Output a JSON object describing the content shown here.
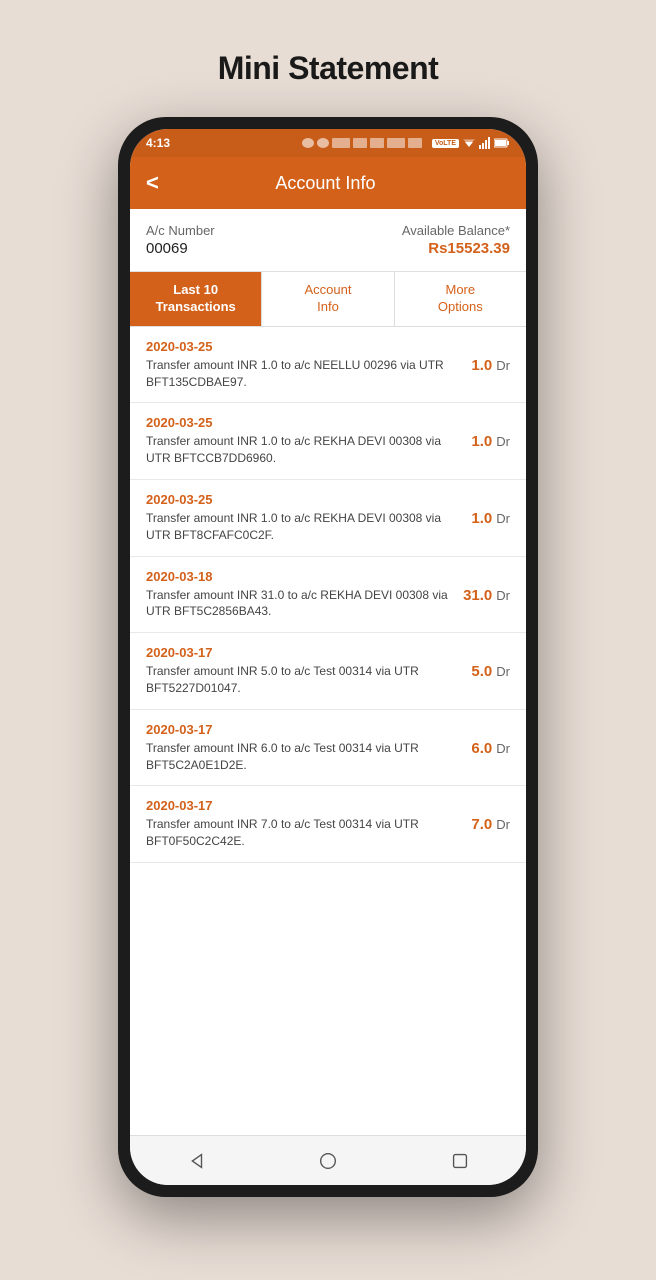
{
  "page": {
    "title": "Mini Statement"
  },
  "status_bar": {
    "time": "4:13",
    "volte": "VoLTE"
  },
  "header": {
    "back_label": "<",
    "title": "Account Info"
  },
  "account": {
    "number_label": "A/c Number",
    "number_value": "00069",
    "balance_label": "Available Balance*",
    "balance_value": "Rs15523.39"
  },
  "tabs": [
    {
      "label": "Last 10\nTransactions",
      "active": true
    },
    {
      "label": "Account\nInfo",
      "active": false
    },
    {
      "label": "More\nOptions",
      "active": false
    }
  ],
  "transactions": [
    {
      "date": "2020-03-25",
      "description": "Transfer amount INR 1.0 to a/c NEELLU 00296 via UTR BFT135CDBAE97.",
      "amount": "1.0",
      "type": "Dr"
    },
    {
      "date": "2020-03-25",
      "description": "Transfer amount INR 1.0 to a/c REKHA DEVI 00308 via UTR BFTCCB7DD6960.",
      "amount": "1.0",
      "type": "Dr"
    },
    {
      "date": "2020-03-25",
      "description": "Transfer amount INR 1.0 to a/c REKHA DEVI 00308 via UTR BFT8CFAFC0C2F.",
      "amount": "1.0",
      "type": "Dr"
    },
    {
      "date": "2020-03-18",
      "description": "Transfer amount INR 31.0 to a/c REKHA DEVI 00308 via UTR BFT5C2856BA43.",
      "amount": "31.0",
      "type": "Dr"
    },
    {
      "date": "2020-03-17",
      "description": "Transfer amount INR 5.0 to a/c Test 00314 via UTR BFT5227D01047.",
      "amount": "5.0",
      "type": "Dr"
    },
    {
      "date": "2020-03-17",
      "description": "Transfer amount INR 6.0 to a/c Test 00314 via UTR BFT5C2A0E1D2E.",
      "amount": "6.0",
      "type": "Dr"
    },
    {
      "date": "2020-03-17",
      "description": "Transfer amount INR 7.0 to a/c Test 00314 via UTR BFT0F50C2C42E.",
      "amount": "7.0",
      "type": "Dr"
    }
  ],
  "nav": {
    "back_icon": "triangle",
    "home_icon": "circle",
    "recent_icon": "square"
  }
}
